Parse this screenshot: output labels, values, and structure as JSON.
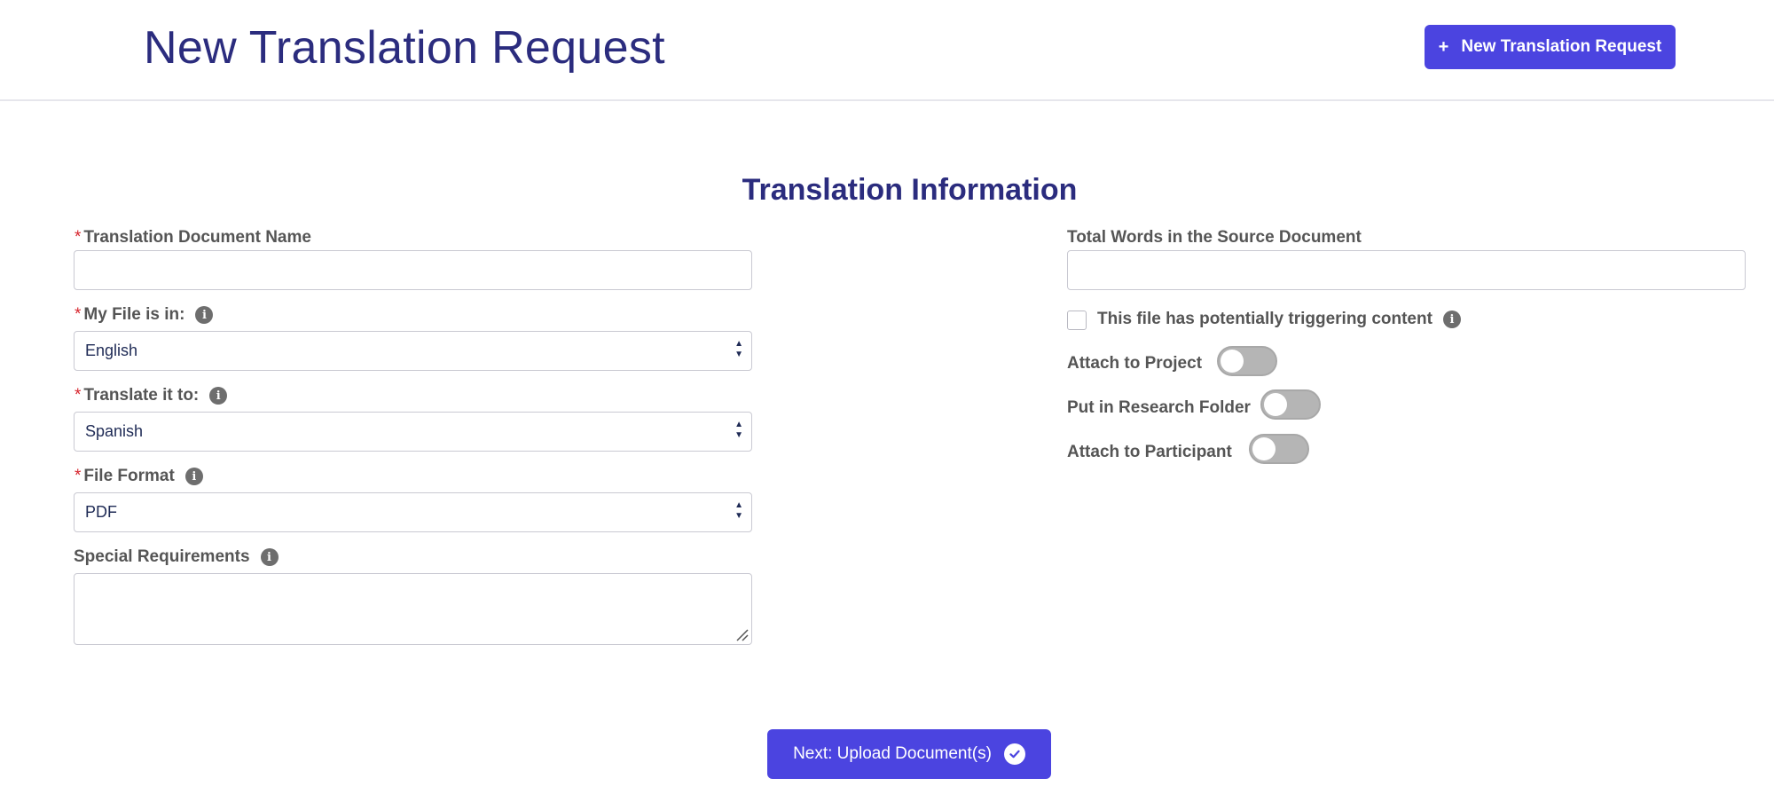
{
  "header": {
    "title": "New Translation Request",
    "new_button_label": "New Translation Request",
    "new_button_icon": "plus-icon"
  },
  "section": {
    "title": "Translation Information"
  },
  "form": {
    "document_name": {
      "label": "Translation Document Name",
      "required": true,
      "value": ""
    },
    "source_language": {
      "label": "My File is in:",
      "required": true,
      "value": "English"
    },
    "target_language": {
      "label": "Translate it to:",
      "required": true,
      "value": "Spanish"
    },
    "file_format": {
      "label": "File Format",
      "required": true,
      "value": "PDF"
    },
    "special_requirements": {
      "label": "Special Requirements",
      "value": ""
    },
    "total_words": {
      "label": "Total Words in the Source Document",
      "value": ""
    },
    "triggering_content": {
      "label": "This file has potentially triggering content",
      "checked": false
    },
    "attach_to_project": {
      "label": "Attach to Project",
      "on": false
    },
    "research_folder": {
      "label": "Put in Research Folder",
      "on": false
    },
    "attach_to_participant": {
      "label": "Attach to Participant",
      "on": false
    }
  },
  "footer": {
    "next_button_label": "Next: Upload Document(s)",
    "next_button_icon": "check-circle-icon"
  },
  "colors": {
    "primary": "#4b44e0",
    "title": "#2b2c7e",
    "required": "#d7262e",
    "toggle_off": "#b5b5b5"
  }
}
